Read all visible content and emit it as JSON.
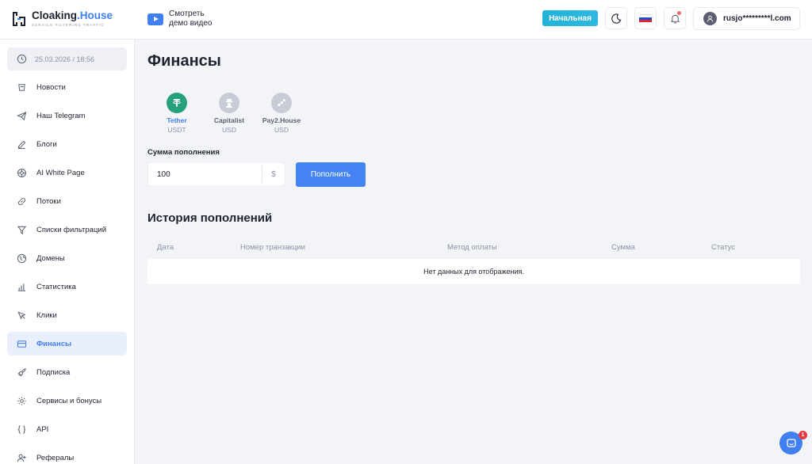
{
  "header": {
    "brand_main": "Cloaking",
    "brand_accent": ".House",
    "brand_tagline": "SERVICE FILTERING TRAFFIC",
    "demo_line1": "Смотреть",
    "demo_line2": "демо видео",
    "plan_label": "Начальная",
    "user_email": "rusjo*********l.com"
  },
  "sidebar": {
    "datetime": "25.03.2026 / 18:56",
    "items": [
      {
        "label": "Новости",
        "icon": "news-icon"
      },
      {
        "label": "Наш Telegram",
        "icon": "telegram-icon"
      },
      {
        "label": "Блоги",
        "icon": "pencil-icon"
      },
      {
        "label": "AI White Page",
        "icon": "ai-brain-icon"
      },
      {
        "label": "Потоки",
        "icon": "link-icon"
      },
      {
        "label": "Списки фильтраций",
        "icon": "filter-icon"
      },
      {
        "label": "Домены",
        "icon": "globe-icon"
      },
      {
        "label": "Статистика",
        "icon": "bar-chart-icon"
      },
      {
        "label": "Клики",
        "icon": "cursor-icon"
      },
      {
        "label": "Финансы",
        "icon": "card-icon",
        "active": true
      },
      {
        "label": "Подписка",
        "icon": "rocket-icon"
      },
      {
        "label": "Сервисы и бонусы",
        "icon": "gear-icon"
      },
      {
        "label": "API",
        "icon": "braces-icon"
      },
      {
        "label": "Рефералы",
        "icon": "user-plus-icon"
      }
    ]
  },
  "main": {
    "title": "Финансы",
    "methods": [
      {
        "name": "Tether",
        "currency": "USDT",
        "selected": true
      },
      {
        "name": "Capitalist",
        "currency": "USD"
      },
      {
        "name": "Pay2.House",
        "currency": "USD"
      }
    ],
    "amount_label": "Сумма пополнения",
    "amount_value": "100",
    "amount_currency": "$",
    "topup_label": "Пополнить",
    "history_title": "История пополнений",
    "columns": [
      "Дата",
      "Номер транзакции",
      "Метод оплаты",
      "Сумма",
      "Статус"
    ],
    "empty_text": "Нет данных для отображения."
  },
  "chat": {
    "badge": "1"
  },
  "colors": {
    "accent": "#3f7ff0",
    "tether": "#26a17b",
    "plan": "#20b2d6"
  }
}
